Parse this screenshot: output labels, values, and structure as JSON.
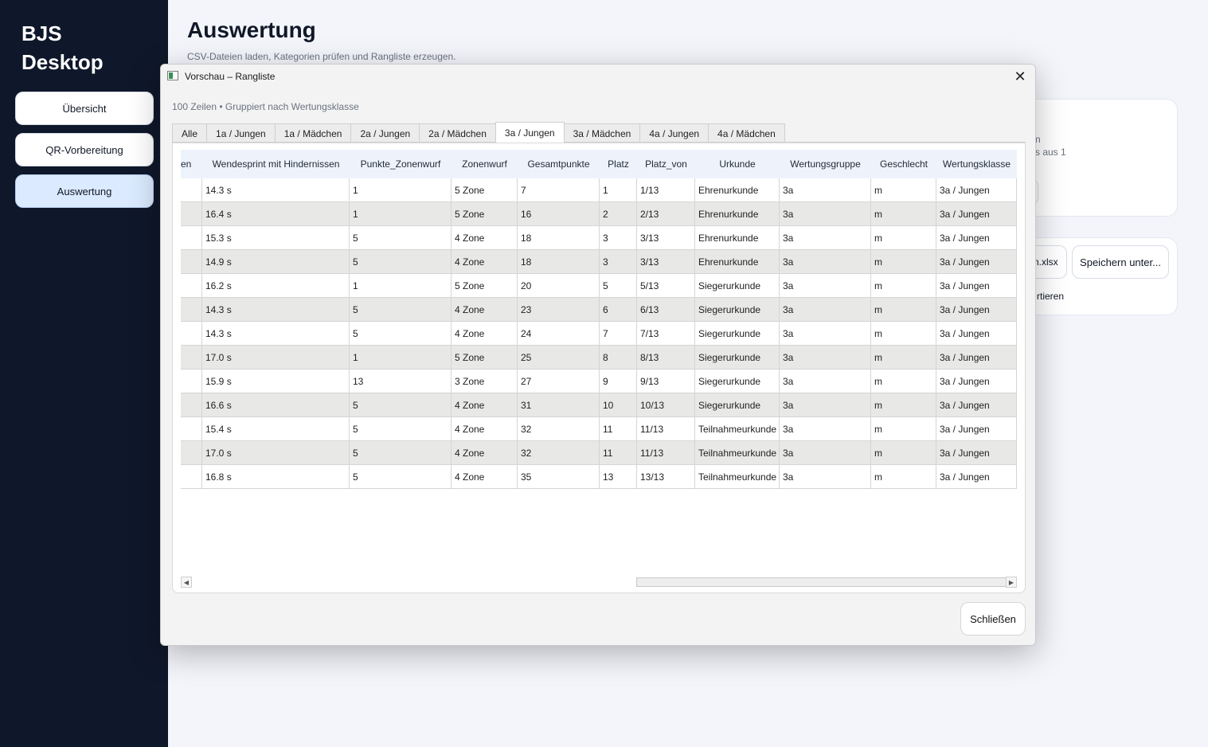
{
  "app": {
    "title_line1": "BJS",
    "title_line2": "Desktop"
  },
  "sidebar": {
    "items": [
      {
        "label": "Übersicht"
      },
      {
        "label": "QR-Vorbereitung"
      },
      {
        "label": "Auswertung"
      }
    ]
  },
  "main": {
    "title": "Auswertung",
    "subtitle": "CSV-Dateien laden, Kategorien prüfen und Rangliste erzeugen.",
    "partial_text_1": "n",
    "partial_text_2": "s aus 1",
    "partial_file_label": "n.xlsx",
    "save_as_label": "Speichern unter...",
    "partial_export_label": "rtieren"
  },
  "dialog": {
    "window_title": "Vorschau – Rangliste",
    "info": "100 Zeilen • Gruppiert nach Wertungsklasse",
    "close_label": "Schließen",
    "tabs": [
      "Alle",
      "1a / Jungen",
      "1a / Mädchen",
      "2a / Jungen",
      "2a / Mädchen",
      "3a / Jungen",
      "3a / Mädchen",
      "4a / Jungen",
      "4a / Mädchen"
    ],
    "active_tab": "3a / Jungen",
    "columns": [
      "en",
      "Wendesprint mit Hindernissen",
      "Punkte_Zonenwurf",
      "Zonenwurf",
      "Gesamtpunkte",
      "Platz",
      "Platz_von",
      "Urkunde",
      "Wertungsgruppe",
      "Geschlecht",
      "Wertungsklasse"
    ],
    "rows": [
      [
        "",
        "14.3 s",
        "1",
        "5 Zone",
        "7",
        "1",
        "1/13",
        "Ehrenurkunde",
        "3a",
        "m",
        "3a / Jungen"
      ],
      [
        "",
        "16.4 s",
        "1",
        "5 Zone",
        "16",
        "2",
        "2/13",
        "Ehrenurkunde",
        "3a",
        "m",
        "3a / Jungen"
      ],
      [
        "",
        "15.3 s",
        "5",
        "4 Zone",
        "18",
        "3",
        "3/13",
        "Ehrenurkunde",
        "3a",
        "m",
        "3a / Jungen"
      ],
      [
        "",
        "14.9 s",
        "5",
        "4 Zone",
        "18",
        "3",
        "3/13",
        "Ehrenurkunde",
        "3a",
        "m",
        "3a / Jungen"
      ],
      [
        "",
        "16.2 s",
        "1",
        "5 Zone",
        "20",
        "5",
        "5/13",
        "Siegerurkunde",
        "3a",
        "m",
        "3a / Jungen"
      ],
      [
        "",
        "14.3 s",
        "5",
        "4 Zone",
        "23",
        "6",
        "6/13",
        "Siegerurkunde",
        "3a",
        "m",
        "3a / Jungen"
      ],
      [
        "",
        "14.3 s",
        "5",
        "4 Zone",
        "24",
        "7",
        "7/13",
        "Siegerurkunde",
        "3a",
        "m",
        "3a / Jungen"
      ],
      [
        "",
        "17.0 s",
        "1",
        "5 Zone",
        "25",
        "8",
        "8/13",
        "Siegerurkunde",
        "3a",
        "m",
        "3a / Jungen"
      ],
      [
        "",
        "15.9 s",
        "13",
        "3 Zone",
        "27",
        "9",
        "9/13",
        "Siegerurkunde",
        "3a",
        "m",
        "3a / Jungen"
      ],
      [
        "",
        "16.6 s",
        "5",
        "4 Zone",
        "31",
        "10",
        "10/13",
        "Siegerurkunde",
        "3a",
        "m",
        "3a / Jungen"
      ],
      [
        "",
        "15.4 s",
        "5",
        "4 Zone",
        "32",
        "11",
        "11/13",
        "Teilnahmeurkunde",
        "3a",
        "m",
        "3a / Jungen"
      ],
      [
        "",
        "17.0 s",
        "5",
        "4 Zone",
        "32",
        "11",
        "11/13",
        "Teilnahmeurkunde",
        "3a",
        "m",
        "3a / Jungen"
      ],
      [
        "",
        "16.8 s",
        "5",
        "4 Zone",
        "35",
        "13",
        "13/13",
        "Teilnahmeurkunde",
        "3a",
        "m",
        "3a / Jungen"
      ]
    ]
  },
  "icons": {
    "window": "window-app-icon",
    "close": "close-icon",
    "scroll_left": "scroll-left-icon",
    "scroll_right": "scroll-right-icon"
  },
  "colors": {
    "sidebar_bg": "#0f172a",
    "active_nav": "#dbeafe",
    "header_bg": "#eef3fb",
    "alt_row": "#e8e8e6"
  }
}
